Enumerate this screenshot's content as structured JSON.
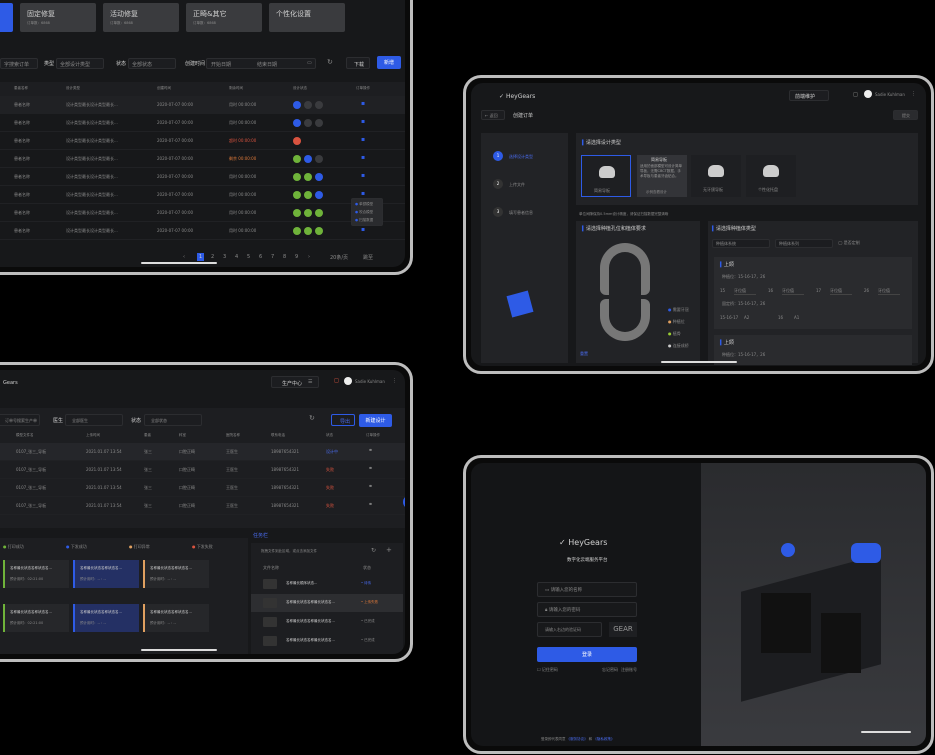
{
  "t1": {
    "cards": [
      {
        "title": "",
        "sub": ""
      },
      {
        "title": "固定修复",
        "sub": "订单数：6868"
      },
      {
        "title": "活动修复",
        "sub": "订单数：6868"
      },
      {
        "title": "正畸&其它",
        "sub": "订单数：6868"
      },
      {
        "title": "个性化设置",
        "sub": ""
      }
    ],
    "filters": {
      "search_placeholder": "字搜索订单",
      "type_label": "类型",
      "type_value": "全部设计类型",
      "status_label": "状态",
      "status_value": "全部状态",
      "time_label": "创建时间",
      "start_placeholder": "开始日期",
      "end_placeholder": "结束日期",
      "download": "下载",
      "add": "新增"
    },
    "headers": [
      "患者名称",
      "设计类型",
      "创建时间",
      "剩余时间",
      "设计状态",
      "订单操作"
    ],
    "rows": [
      {
        "name": "患者名称",
        "type": "设计类型最长设计类型最长...",
        "date": "2020-07-07 00:00",
        "remain": "用时 00:00:00",
        "remain_color": "",
        "icons": [
          "#2e5be6",
          "#3a3b3e",
          "#3a3b3e"
        ]
      },
      {
        "name": "患者名称",
        "type": "设计类型最长设计类型最长...",
        "date": "2020-07-07 00:00",
        "remain": "用时 00:00:00",
        "remain_color": "",
        "icons": [
          "#2e5be6",
          "#3a3b3e",
          "#3a3b3e"
        ]
      },
      {
        "name": "患者名称",
        "type": "设计类型最长设计类型最长...",
        "date": "2020-07-07 00:00",
        "remain": "超时 00:00:00",
        "remain_color": "red",
        "icons": [
          "#d9533f"
        ]
      },
      {
        "name": "患者名称",
        "type": "设计类型最长设计类型最长...",
        "date": "2020-07-07 00:00",
        "remain": "剩余 00:00:00",
        "remain_color": "org",
        "icons": [
          "#6fb33a",
          "#2e5be6",
          "#3a3b3e"
        ]
      },
      {
        "name": "患者名称",
        "type": "设计类型最长设计类型最长...",
        "date": "2020-07-07 00:00",
        "remain": "用时 00:00:00",
        "remain_color": "",
        "icons": [
          "#6fb33a",
          "#6fb33a",
          "#2e5be6"
        ]
      },
      {
        "name": "患者名称",
        "type": "设计类型最长设计类型最长...",
        "date": "2020-07-07 00:00",
        "remain": "用时 00:00:00",
        "remain_color": "",
        "icons": [
          "#6fb33a",
          "#6fb33a",
          "#2e5be6"
        ]
      },
      {
        "name": "患者名称",
        "type": "设计类型最长设计类型最长...",
        "date": "2020-07-07 00:00",
        "remain": "用时 00:00:00",
        "remain_color": "",
        "icons": [
          "#6fb33a",
          "#6fb33a",
          "#6fb33a"
        ]
      },
      {
        "name": "患者名称",
        "type": "设计类型最长设计类型最长...",
        "date": "2020-07-07 00:00",
        "remain": "用时 00:00:00",
        "remain_color": "",
        "icons": [
          "#6fb33a",
          "#6fb33a",
          "#6fb33a"
        ]
      }
    ],
    "popup": [
      "单颌模型",
      "咬合模型",
      "扫描数据"
    ],
    "pages": [
      "1",
      "2",
      "3",
      "4",
      "5",
      "6",
      "7",
      "8",
      "9"
    ],
    "page_size": "20条/页",
    "goto": "跳至"
  },
  "t2": {
    "logo": "HeyGears",
    "prod_center": "前端维护",
    "user": "Sadie Kuhlman",
    "back": "← 返回",
    "page_title": "创建订单",
    "next": "提交",
    "steps": [
      {
        "n": "1",
        "label": "选择设计类型"
      },
      {
        "n": "2",
        "label": "上传文件"
      },
      {
        "n": "3",
        "label": "填写患者信息"
      }
    ],
    "design_title": "请选择设计类型",
    "types": [
      "简易导板",
      "",
      "无牙颌导板",
      "个性化托盘"
    ],
    "tip_title": "简易导板",
    "tip_text": "适用於面部模型可设计简单导板，无需CBCT数据，手术导板与患者牙齿贴合。",
    "tip_link": "示例查看设计",
    "note": "单位间隙保持0.5mm设计精度，请保证扫描数据完整清晰",
    "implant_title": "请选择种植孔位和植体要求",
    "legend": [
      "需要牙冠",
      "种植位",
      "植骨",
      "连接成桥"
    ],
    "reset": "重置",
    "type_title": "请选择种植体类型",
    "sel1": "种植体系统",
    "sel2": "种植体系列",
    "chk": "是否定制",
    "upper": "上颌",
    "pos": "种植位：15-16-17，26",
    "teeth": [
      "15",
      "16",
      "17",
      "26"
    ],
    "tval": "牙位值",
    "bridge": "固定桥：15-16-17，26",
    "b1": "15-16-17",
    "b1v": "A2",
    "b2": "16",
    "b2v": "A1",
    "upper2": "上颌",
    "pos2": "种植位：15-16-17，26"
  },
  "t3": {
    "logo": "Gears",
    "prod_center": "生产中心",
    "user": "Sadie Kuhlman",
    "search_placeholder": "订单号搜索生产单",
    "doc_label": "医生",
    "doc_value": "全部医生",
    "status_label": "状态",
    "status_value": "全部状态",
    "export": "导出",
    "new": "新建设计",
    "headers": [
      "模型文件名",
      "上传时间",
      "患者",
      "科室",
      "医院名称",
      "联系电话",
      "状态",
      "订单操作"
    ],
    "rows": [
      {
        "file": "0107_张三_导板",
        "time": "2021.01.07 13:54",
        "patient": "张三",
        "dept": "口腔正畸",
        "hosp": "王医生",
        "tel": "18987654321",
        "status": "设计中",
        "cls": "blue"
      },
      {
        "file": "0107_张三_导板",
        "time": "2021.01.07 13:54",
        "patient": "张三",
        "dept": "口腔正畸",
        "hosp": "王医生",
        "tel": "18987654321",
        "status": "失败",
        "cls": "red"
      },
      {
        "file": "0107_张三_导板",
        "time": "2021.01.07 13:54",
        "patient": "张三",
        "dept": "口腔正畸",
        "hosp": "王医生",
        "tel": "18987654321",
        "status": "失败",
        "cls": "red"
      },
      {
        "file": "0107_张三_导板",
        "time": "2021.01.07 13:54",
        "patient": "张三",
        "dept": "口腔正畸",
        "hosp": "王医生",
        "tel": "18987654321",
        "status": "失败",
        "cls": "red"
      }
    ],
    "legend": [
      {
        "label": "打印成功",
        "color": "#6fb33a"
      },
      {
        "label": "下发成功",
        "color": "#2e5be6"
      },
      {
        "label": "打印异常",
        "color": "#e0a060"
      },
      {
        "label": "下发失败",
        "color": "#d9533f"
      }
    ],
    "cards": [
      {
        "name": "名称最长状态名称状态名...",
        "time": "预计用时：02:21:00",
        "color": "#6fb33a"
      },
      {
        "name": "名称最长状态名称状态名...",
        "time": "预计用时：-- : --",
        "color": "#2e5be6"
      },
      {
        "name": "名称最长状态名称状态名...",
        "time": "预计用时：-- : --",
        "color": "#e0a060"
      },
      {
        "name": "名称最长状态名称状态名...",
        "time": "预计用时：02:21:00",
        "color": "#6fb33a"
      },
      {
        "name": "名称最长状态名称状态名...",
        "time": "预计用时：-- : --",
        "color": "#2e5be6"
      },
      {
        "name": "名称最长状态名称状态名...",
        "time": "预计用时：-- : --",
        "color": "#e0a060"
      }
    ],
    "task_title": "任务栏",
    "task_hint": "拖拽文件到此区域，或点击添加文件",
    "task_headers": [
      "文件名称",
      "状态"
    ],
    "tasks": [
      {
        "name": "名称最长顺序状态...",
        "status": "• 待传",
        "cls": "blue"
      },
      {
        "name": "名称最长状态名称最长状态名...",
        "status": "• 上传失败",
        "cls": "org"
      },
      {
        "name": "名称最长状态名称最长状态名...",
        "status": "• 已完成",
        "cls": ""
      },
      {
        "name": "名称最长状态名称最长状态名...",
        "status": "• 已完成",
        "cls": ""
      }
    ]
  },
  "t4": {
    "lang": "中文",
    "logo": "HeyGears",
    "subtitle": "数字化云端服务平台",
    "user_placeholder": "请输入您的名称",
    "pwd_placeholder": "请输入您的密码",
    "code_placeholder": "请输入右边的验证码",
    "captcha": "GEAR",
    "login": "登录",
    "remember": "记住密码",
    "forgot": "忘记密码",
    "register": "注册账号",
    "footer": "登录即代表同意",
    "link1": "《服务协议》",
    "and": "和",
    "link2": "《隐私政策》"
  },
  "colors": {
    "accent": "#2e5be6",
    "bg": "#17181a",
    "panel": "#1f2023"
  }
}
